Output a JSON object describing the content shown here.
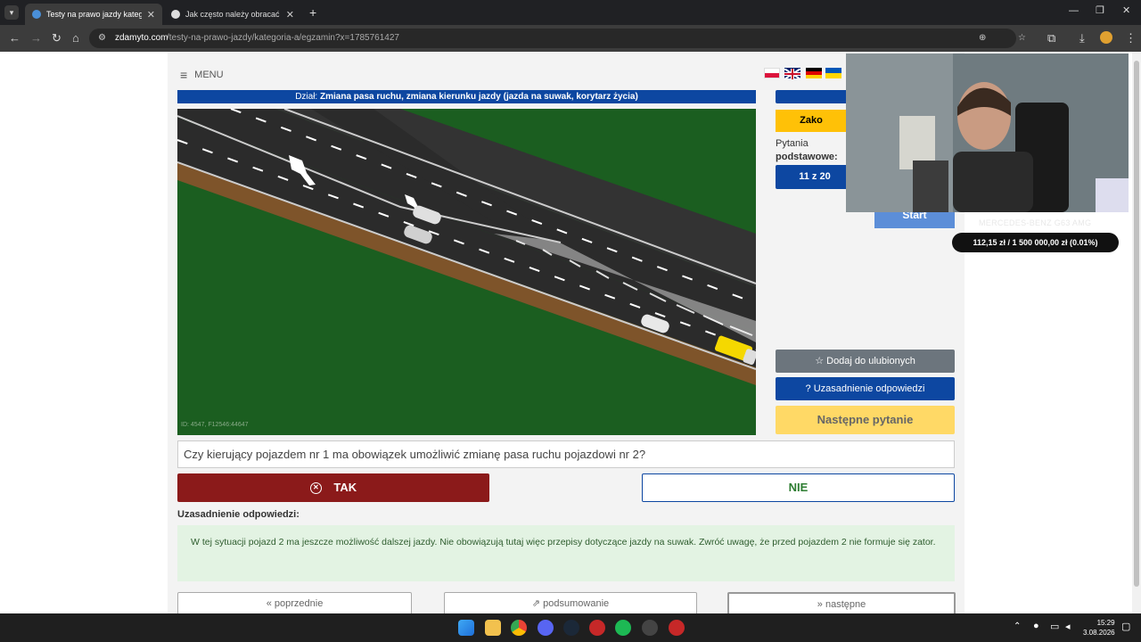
{
  "browser": {
    "tabs": [
      {
        "title": "Testy na prawo jazdy kategoria",
        "active": true
      },
      {
        "title": "Jak często należy obracać poszl",
        "active": false
      }
    ],
    "new_tab_glyph": "+",
    "url_domain": "zdamyto.com",
    "url_path": "/testy-na-prawo-jazdy/kategoria-a/egzamin?x=1785761427"
  },
  "menu": {
    "label": "MENU"
  },
  "section": {
    "prefix": "Dział:",
    "title": "Zmiana pasa ruchu, zmiana kierunku jazdy (jazda na suwak, korytarz życia)"
  },
  "scene": {
    "id_text": "ID: 4547, F12546:44647"
  },
  "sidebar": {
    "finish_label": "Zako",
    "questions_label": "Pytania",
    "questions_type": "podstawowe:",
    "counter": "11 z 20",
    "start_label": "Start",
    "favorite_label": "Dodaj do ulubionych",
    "justification_label": "Uzasadnienie odpowiedzi",
    "next_question_label": "Następne pytanie"
  },
  "overlay": {
    "watermark": "MERCEDES-BENZ G63 AMG",
    "goal": "112,15 zł / 1 500 000,00 zł (0.01%)"
  },
  "question": {
    "text": "Czy kierujący pojazdem nr 1 ma obowiązek umożliwić zmianę pasa ruchu pojazdowi nr 2?"
  },
  "answers": {
    "yes": "TAK",
    "no": "NIE"
  },
  "explanation": {
    "label": "Uzasadnienie odpowiedzi:",
    "text": "W tej sytuacji pojazd 2 ma jeszcze możliwość dalszej jazdy. Nie obowiązują tutaj więc przepisy dotyczące jazdy na suwak. Zwróć uwagę, że przed pojazdem 2 nie formuje się zator."
  },
  "navigation": {
    "prev": "poprzednie",
    "summary": "podsumowanie",
    "next": "następne"
  },
  "taskbar": {
    "time": "15:29",
    "date": "3.08.2026"
  },
  "colors": {
    "blue": "#0d47a1",
    "yellow": "#ffc107",
    "red": "#8b1a1a",
    "green": "#2e7d32",
    "grass": "#1b5e20"
  }
}
